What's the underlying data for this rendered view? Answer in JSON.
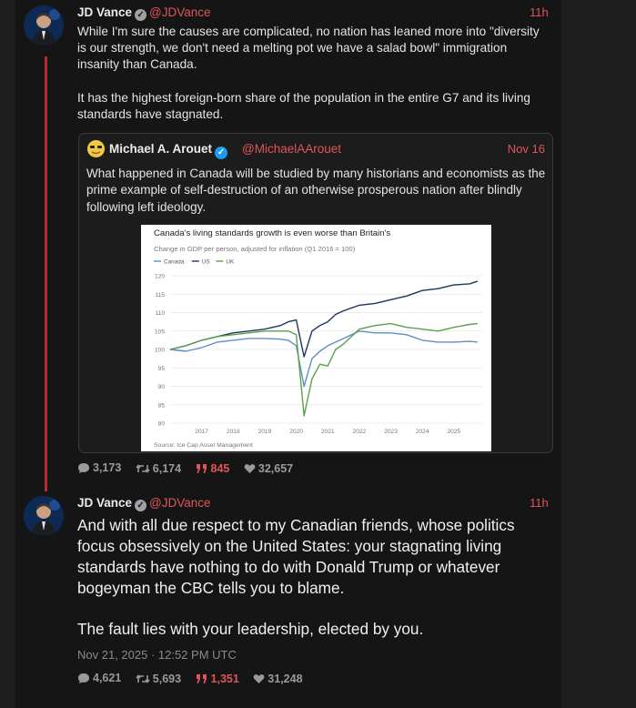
{
  "posts": [
    {
      "author": "JD Vance",
      "handle": "@JDVance",
      "time": "11h",
      "paragraphs": [
        "While I'm sure the causes are complicated, no nation has leaned more into \"diversity is our strength, we don't need a melting pot we have a salad bowl\" immigration insanity than Canada.",
        "It has the highest foreign-born share of the population in the entire G7 and its living standards have stagnated."
      ],
      "quote": {
        "author": "Michael A. Arouet",
        "handle": "@MichaelAArouet",
        "time": "Nov 16",
        "text": "What happened in Canada will be studied by many historians and economists as the prime example of self-destruction of an otherwise prosperous nation after blindly following left ideology."
      },
      "stats": {
        "replies": "3,173",
        "reposts": "6,174",
        "quotes": "845",
        "likes": "32,657"
      }
    },
    {
      "author": "JD Vance",
      "handle": "@JDVance",
      "time": "11h",
      "paragraphs": [
        "And with all due respect to my Canadian friends, whose politics focus obsessively on the United States: your stagnating living standards have nothing to do with Donald Trump or whatever bogeyman the CBC tells you to blame.",
        "The fault lies with your leadership, elected by you."
      ],
      "date": "Nov 21, 2025 · 12:52 PM UTC",
      "stats": {
        "replies": "4,621",
        "reposts": "5,693",
        "quotes": "1,351",
        "likes": "31,248"
      }
    }
  ],
  "chart_data": {
    "type": "line",
    "title": "Canada's living standards growth is even worse than Britain's",
    "subtitle": "Change in GDP per person, adjusted for inflation (Q1 2016 = 100)",
    "source": "Source: Ice Cap Asset Management",
    "x": [
      2016.0,
      2016.5,
      2017.0,
      2017.5,
      2018.0,
      2018.5,
      2019.0,
      2019.5,
      2019.75,
      2020.0,
      2020.25,
      2020.5,
      2020.75,
      2021.0,
      2021.25,
      2021.5,
      2022.0,
      2022.5,
      2023.0,
      2023.5,
      2024.0,
      2024.5,
      2025.0,
      2025.5,
      2025.75
    ],
    "xticks": [
      "2017",
      "2018",
      "2019",
      "2020",
      "2021",
      "2022",
      "2023",
      "2024",
      "2025"
    ],
    "xtick_values": [
      2017,
      2018,
      2019,
      2020,
      2021,
      2022,
      2023,
      2024,
      2025
    ],
    "ylim": [
      80,
      120
    ],
    "yticks": [
      "80",
      "85",
      "90",
      "95",
      "100",
      "105",
      "110",
      "115",
      "120"
    ],
    "ytick_values": [
      80,
      85,
      90,
      95,
      100,
      105,
      110,
      115,
      120
    ],
    "series": [
      {
        "name": "Canada",
        "color": "#5b8fc7",
        "values": [
          100,
          99.5,
          100.5,
          102,
          102.5,
          103,
          103,
          102.8,
          102.5,
          101,
          90,
          97.5,
          99.5,
          101,
          102,
          103,
          105,
          104.5,
          104.5,
          104,
          102.5,
          102,
          102,
          102.2,
          102
        ]
      },
      {
        "name": "US",
        "color": "#1d3561",
        "values": [
          100,
          101,
          102.5,
          103.5,
          104.5,
          105,
          105.5,
          106.5,
          107.5,
          108,
          98,
          105,
          106.5,
          107.5,
          109.5,
          110.5,
          112,
          112.5,
          113.5,
          114.5,
          116,
          116.5,
          117.5,
          117.8,
          118.5
        ]
      },
      {
        "name": "UK",
        "color": "#5aa14a",
        "values": [
          100,
          101,
          102.5,
          103.5,
          104,
          104.5,
          105,
          105,
          105,
          104,
          82,
          92,
          96,
          95.5,
          100,
          101.5,
          105.5,
          106.5,
          107,
          106,
          105.5,
          105,
          106,
          106.8,
          107
        ]
      }
    ]
  }
}
